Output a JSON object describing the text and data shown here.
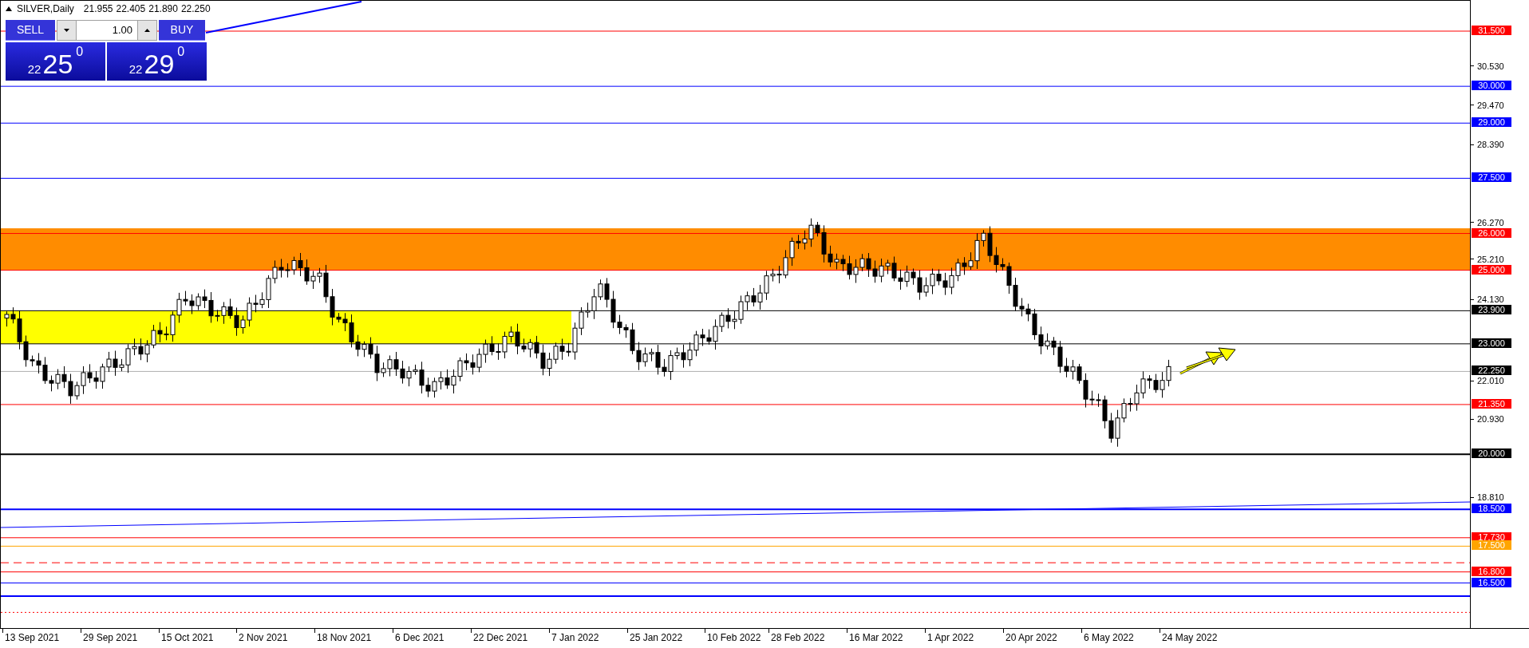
{
  "header": {
    "symbol": "SILVER,Daily",
    "ohlc": [
      "21.955",
      "22.405",
      "21.890",
      "22.250"
    ]
  },
  "trade_panel": {
    "sell_label": "SELL",
    "buy_label": "BUY",
    "volume": "1.00",
    "sell_price": {
      "big": "22",
      "main": "25",
      "small": "0"
    },
    "buy_price": {
      "big": "22",
      "main": "29",
      "small": "0"
    }
  },
  "price_axis": {
    "ticks": [
      "30.530",
      "29.470",
      "28.390",
      "26.270",
      "25.210",
      "24.130",
      "22.010",
      "20.930",
      "18.810"
    ]
  },
  "levels": [
    {
      "label": "31.500",
      "color": "#ff0000",
      "kind": "line"
    },
    {
      "label": "30.000",
      "color": "#0000ff",
      "kind": "line"
    },
    {
      "label": "29.000",
      "color": "#0000ff",
      "kind": "line"
    },
    {
      "label": "27.500",
      "color": "#0000ff",
      "kind": "line"
    },
    {
      "label": "26.000",
      "color": "#ff0000",
      "kind": "line"
    },
    {
      "label": "25.000",
      "color": "#ff0000",
      "kind": "line"
    },
    {
      "label": "23.900",
      "color": "#000000",
      "kind": "line"
    },
    {
      "label": "23.000",
      "color": "#000000",
      "kind": "line"
    },
    {
      "label": "22.250",
      "color": "#000000",
      "kind": "current"
    },
    {
      "label": "21.350",
      "color": "#ff0000",
      "kind": "line"
    },
    {
      "label": "20.000",
      "color": "#000000",
      "kind": "thick"
    },
    {
      "label": "18.500",
      "color": "#0000ff",
      "kind": "thick"
    },
    {
      "label": "17.730",
      "color": "#ff0000",
      "kind": "line"
    },
    {
      "label": "17.500",
      "color": "#ffa500",
      "kind": "line"
    },
    {
      "label": "16.800",
      "color": "#ff0000",
      "kind": "line"
    },
    {
      "label": "16.500",
      "color": "#0000ff",
      "kind": "line"
    }
  ],
  "dates": [
    "13 Sep 2021",
    "29 Sep 2021",
    "15 Oct 2021",
    "2 Nov 2021",
    "18 Nov 2021",
    "6 Dec 2021",
    "22 Dec 2021",
    "7 Jan 2022",
    "25 Jan 2022",
    "10 Feb 2022",
    "28 Feb 2022",
    "16 Mar 2022",
    "1 Apr 2022",
    "20 Apr 2022",
    "6 May 2022",
    "24 May 2022"
  ]
}
